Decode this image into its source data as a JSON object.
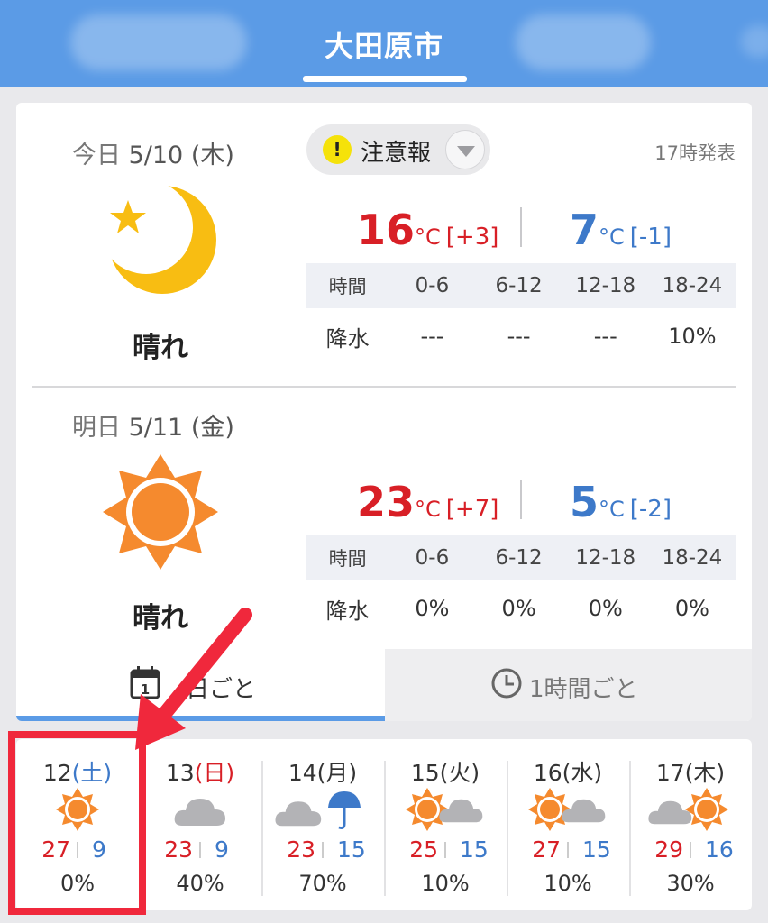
{
  "header": {
    "city": "大田原市"
  },
  "alert": {
    "label": "注意報",
    "icon": "!"
  },
  "issued": "17時発表",
  "today": {
    "rel": "今日",
    "date": "5/10",
    "dow": "(木)",
    "weather": "晴れ",
    "icon": "clear-night-icon",
    "high": "16",
    "high_diff": "[+3]",
    "low": "7",
    "low_diff": "[-1]",
    "unit": "°C",
    "rain": [
      "---",
      "---",
      "---",
      "10%"
    ]
  },
  "tomorrow": {
    "rel": "明日",
    "date": "5/11",
    "dow": "(金)",
    "weather": "晴れ",
    "icon": "sunny-icon",
    "high": "23",
    "high_diff": "[+7]",
    "low": "5",
    "low_diff": "[-2]",
    "unit": "°C",
    "rain": [
      "0%",
      "0%",
      "0%",
      "0%"
    ]
  },
  "table": {
    "time_label": "時間",
    "rain_label": "降水",
    "periods": [
      "0-6",
      "6-12",
      "12-18",
      "18-24"
    ]
  },
  "tabs": {
    "daily": "日ごと",
    "hourly": "1時間ごと",
    "daily_num": "1"
  },
  "week": [
    {
      "day": "12",
      "dow": "(土)",
      "dow_color": "sat",
      "icons": [
        "sun"
      ],
      "high": "27",
      "low": "9",
      "pct": "0%"
    },
    {
      "day": "13",
      "dow": "(日)",
      "dow_color": "sun",
      "icons": [
        "cloud"
      ],
      "high": "23",
      "low": "9",
      "pct": "40%"
    },
    {
      "day": "14",
      "dow": "(月)",
      "dow_color": "",
      "icons": [
        "cloud",
        "umbrella"
      ],
      "high": "23",
      "low": "15",
      "pct": "70%"
    },
    {
      "day": "15",
      "dow": "(火)",
      "dow_color": "",
      "icons": [
        "sun",
        "cloud"
      ],
      "high": "25",
      "low": "15",
      "pct": "10%"
    },
    {
      "day": "16",
      "dow": "(水)",
      "dow_color": "",
      "icons": [
        "sun",
        "cloud"
      ],
      "high": "27",
      "low": "15",
      "pct": "10%"
    },
    {
      "day": "17",
      "dow": "(木)",
      "dow_color": "",
      "icons": [
        "cloud",
        "sun"
      ],
      "high": "29",
      "low": "16",
      "pct": "30%"
    }
  ],
  "colors": {
    "header": "#5b9be6",
    "high": "#d81f26",
    "low": "#3d79c9",
    "annotation": "#f0283c"
  }
}
